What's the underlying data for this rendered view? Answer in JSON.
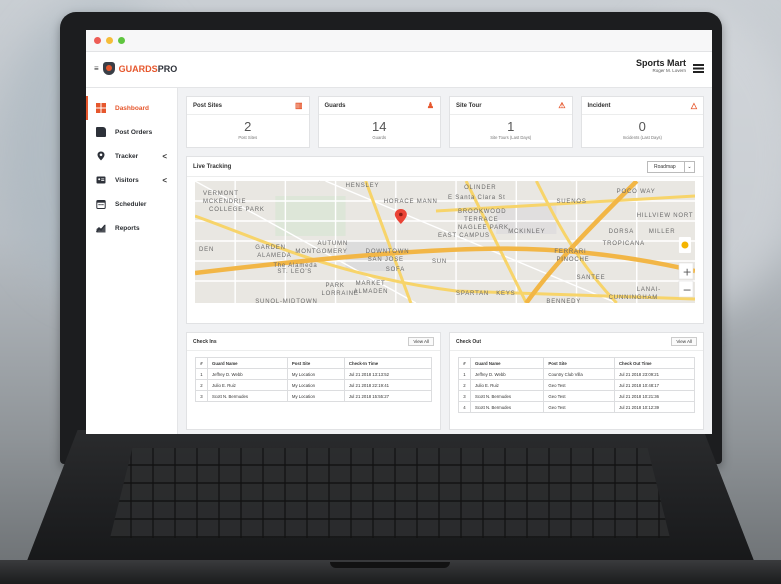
{
  "app": {
    "logo_text_red": "GUARDS",
    "logo_text_dark": "PRO",
    "org_name": "Sports Mart",
    "user_name": "Roger M. Lovern"
  },
  "sidebar": {
    "items": [
      {
        "label": "Dashboard",
        "icon": "dashboard-grid-icon",
        "active": true
      },
      {
        "label": "Post Orders",
        "icon": "document-icon",
        "active": false
      },
      {
        "label": "Tracker",
        "icon": "map-pin-icon",
        "active": false,
        "caret": "<"
      },
      {
        "label": "Visitors",
        "icon": "id-card-icon",
        "active": false,
        "caret": "<"
      },
      {
        "label": "Scheduler",
        "icon": "calendar-icon",
        "active": false
      },
      {
        "label": "Reports",
        "icon": "chart-icon",
        "active": false
      }
    ]
  },
  "cards": [
    {
      "title": "Post Sites",
      "value": "2",
      "subtitle": "Post Sites",
      "icon": "building-icon"
    },
    {
      "title": "Guards",
      "value": "14",
      "subtitle": "Guards",
      "icon": "guard-icon"
    },
    {
      "title": "Site Tour",
      "value": "1",
      "subtitle": "Site Tours (Last Days)",
      "icon": "site-tour-icon"
    },
    {
      "title": "Incident",
      "value": "0",
      "subtitle": "Incidents (Last Days)",
      "icon": "warning-icon"
    }
  ],
  "tracking": {
    "title": "Live Tracking",
    "map_type": "Roadmap",
    "map_labels": [
      "VERMONT",
      "MCKENDRIE",
      "COLLEGE PARK",
      "HENSLEY",
      "HORACE MANN",
      "OLINDER",
      "BROOKWOOD",
      "TERRACE",
      "NAGLEE PARK",
      "EAST CAMPUS",
      "MCKINLEY",
      "SUENOS",
      "POCO WAY",
      "HILLVIEW NORT",
      "DORSA",
      "MILLER",
      "TROPICANA",
      "FERRARI",
      "PINOCHE",
      "DEN",
      "GARDEN",
      "ALAMEDA",
      "AUTUMN",
      "MONTGOMERY",
      "DOWNTOWN",
      "SAN JOSE",
      "SOFA",
      "SUN",
      "ST. LEO'S",
      "PARK",
      "LORRAINE",
      "MARKET",
      "ALMADEN",
      "SPARTAN",
      "KEYS",
      "SANTEE",
      "LANAI-",
      "CUNNINGHAM",
      "BENNEDY",
      "SUNOL-MIDTOWN",
      "The Alameda",
      "E Santa Clara St"
    ]
  },
  "checkins": {
    "title": "Check Ins",
    "view_all": "View All",
    "headers": [
      "#",
      "Guard Name",
      "Post Site",
      "Check-In Time"
    ],
    "rows": [
      [
        "1",
        "Jeffrey D. Webb",
        "My Location",
        "Jul 21 2018 13:13:52"
      ],
      [
        "2",
        "Julio E. Ruiz",
        "My Location",
        "Jul 21 2018 22:19:41"
      ],
      [
        "3",
        "Scott N. Bermudes",
        "My Location",
        "Jul 21 2018 15:55:27"
      ]
    ]
  },
  "checkouts": {
    "title": "Check Out",
    "view_all": "View All",
    "headers": [
      "#",
      "Guard Name",
      "Post Site",
      "Check Out Time"
    ],
    "rows": [
      [
        "1",
        "Jeffrey D. Webb",
        "Country Club Villa",
        "Jul 21 2018 23:09:21"
      ],
      [
        "2",
        "Julio E. Ruiz",
        "Geo Test",
        "Jul 21 2018 10:48:17"
      ],
      [
        "3",
        "Scott N. Bermudes",
        "Geo Test",
        "Jul 21 2018 10:21:36"
      ],
      [
        "4",
        "Scott N. Bermudes",
        "Geo Test",
        "Jul 21 2018 10:12:39"
      ]
    ]
  },
  "colors": {
    "accent": "#e6572d",
    "dark": "#2d3139"
  }
}
